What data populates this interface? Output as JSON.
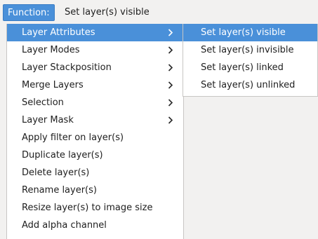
{
  "function_bar": {
    "label": "Function:",
    "value": "Set layer(s) visible"
  },
  "menu": {
    "items": [
      {
        "label": "Layer Attributes",
        "submenu": true,
        "active": true
      },
      {
        "label": "Layer Modes",
        "submenu": true
      },
      {
        "label": "Layer Stackposition",
        "submenu": true
      },
      {
        "label": "Merge Layers",
        "submenu": true
      },
      {
        "label": "Selection",
        "submenu": true
      },
      {
        "label": "Layer Mask",
        "submenu": true
      },
      {
        "label": "Apply filter on layer(s)"
      },
      {
        "label": "Duplicate layer(s)"
      },
      {
        "label": "Delete layer(s)"
      },
      {
        "label": "Rename layer(s)"
      },
      {
        "label": "Resize layer(s) to image size"
      },
      {
        "label": "Add alpha channel"
      }
    ]
  },
  "submenu": {
    "items": [
      {
        "label": "Set layer(s) visible",
        "active": true
      },
      {
        "label": "Set layer(s) invisible"
      },
      {
        "label": "Set layer(s) linked"
      },
      {
        "label": "Set layer(s) unlinked"
      }
    ]
  },
  "colors": {
    "highlight": "#4a90d9",
    "menu_background": "#ffffff",
    "window_background": "#f2f1f0"
  }
}
